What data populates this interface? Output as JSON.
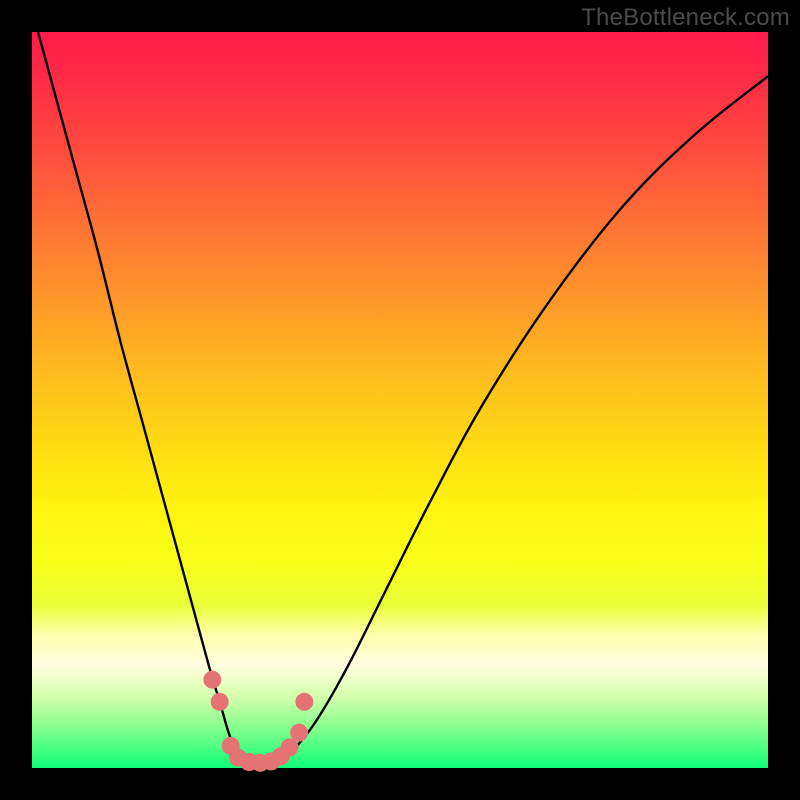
{
  "watermark": "TheBottleneck.com",
  "colors": {
    "frame": "#000000",
    "curve": "#000000",
    "marker_fill": "#e57373",
    "marker_stroke": "#c95c5c"
  },
  "chart_data": {
    "type": "line",
    "title": "",
    "xlabel": "",
    "ylabel": "",
    "xlim": [
      0,
      100
    ],
    "ylim": [
      0,
      100
    ],
    "grid": false,
    "legend": false,
    "series": [
      {
        "name": "bottleneck-curve",
        "x": [
          0,
          3,
          6,
          9,
          12,
          15,
          18,
          21,
          24,
          25.5,
          27,
          28.5,
          30,
          32,
          34,
          36,
          39,
          43,
          48,
          54,
          61,
          70,
          80,
          90,
          100
        ],
        "y": [
          103,
          92,
          81,
          70,
          58,
          47,
          36,
          25,
          14,
          9,
          4,
          1.5,
          0.5,
          0.5,
          1.2,
          3,
          7,
          14,
          24,
          36,
          49,
          63,
          76,
          86,
          94
        ]
      }
    ],
    "markers": [
      {
        "x": 24.5,
        "y": 12
      },
      {
        "x": 25.5,
        "y": 9
      },
      {
        "x": 27.0,
        "y": 3.0
      },
      {
        "x": 28.0,
        "y": 1.4
      },
      {
        "x": 29.5,
        "y": 0.8
      },
      {
        "x": 31.0,
        "y": 0.7
      },
      {
        "x": 32.5,
        "y": 0.9
      },
      {
        "x": 33.8,
        "y": 1.6
      },
      {
        "x": 35.0,
        "y": 2.8
      },
      {
        "x": 36.3,
        "y": 4.8
      },
      {
        "x": 37.0,
        "y": 9.0
      }
    ]
  }
}
